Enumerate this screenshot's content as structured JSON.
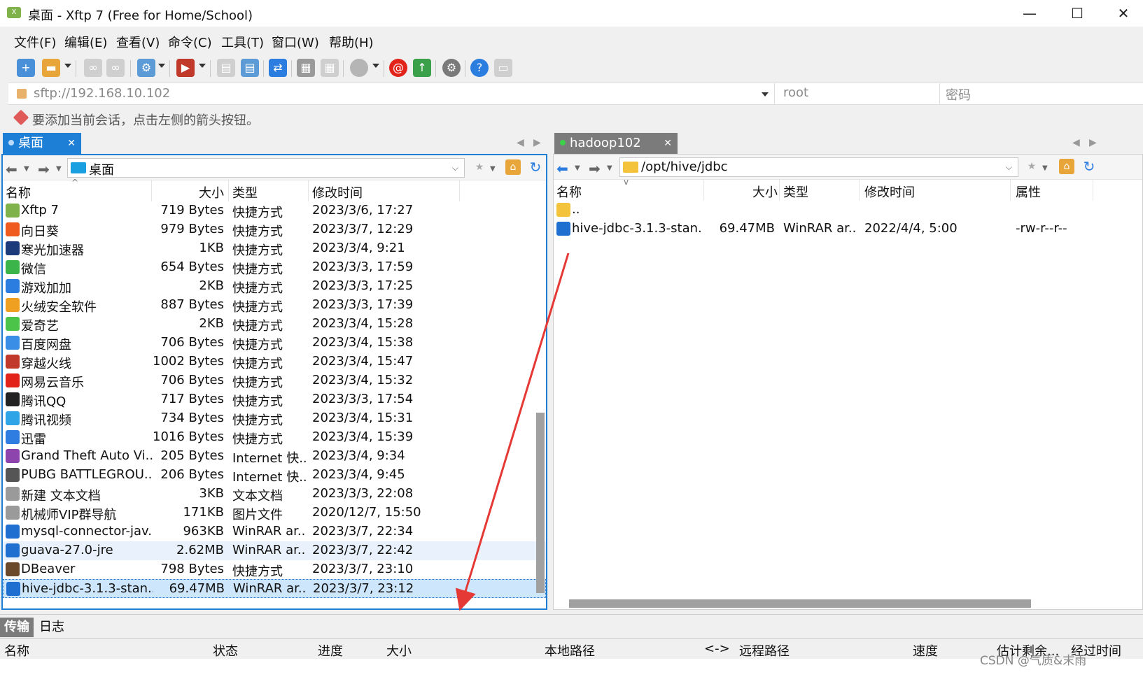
{
  "window": {
    "title": "桌面 - Xftp 7 (Free for Home/School)"
  },
  "menu": [
    "文件(F)",
    "编辑(E)",
    "查看(V)",
    "命令(C)",
    "工具(T)",
    "窗口(W)",
    "帮助(H)"
  ],
  "address": {
    "url": "sftp://192.168.10.102",
    "user": "root",
    "password": "密码"
  },
  "hint": "要添加当前会话，点击左侧的箭头按钮。",
  "local": {
    "tab": "桌面",
    "path": "桌面",
    "columns": [
      "名称",
      "大小",
      "类型",
      "修改时间"
    ],
    "files": [
      {
        "name": "Xftp 7",
        "size": "719 Bytes",
        "type": "快捷方式",
        "modified": "2023/3/6, 17:27",
        "icon": "xftp-icon",
        "color": "#7fb24a"
      },
      {
        "name": "向日葵",
        "size": "979 Bytes",
        "type": "快捷方式",
        "modified": "2023/3/7, 12:29",
        "icon": "sunflower-icon",
        "color": "#ef5a1f"
      },
      {
        "name": "寒光加速器",
        "size": "1KB",
        "type": "快捷方式",
        "modified": "2023/3/4, 9:21",
        "icon": "accelerator-icon",
        "color": "#1d3b7a"
      },
      {
        "name": "微信",
        "size": "654 Bytes",
        "type": "快捷方式",
        "modified": "2023/3/3, 17:59",
        "icon": "wechat-icon",
        "color": "#3bb54a"
      },
      {
        "name": "游戏加加",
        "size": "2KB",
        "type": "快捷方式",
        "modified": "2023/3/3, 17:25",
        "icon": "game-icon",
        "color": "#2b7de0"
      },
      {
        "name": "火绒安全软件",
        "size": "887 Bytes",
        "type": "快捷方式",
        "modified": "2023/3/3, 17:39",
        "icon": "huorong-icon",
        "color": "#f0a020"
      },
      {
        "name": "爱奇艺",
        "size": "2KB",
        "type": "快捷方式",
        "modified": "2023/3/4, 15:28",
        "icon": "iqiyi-icon",
        "color": "#4cc44a"
      },
      {
        "name": "百度网盘",
        "size": "706 Bytes",
        "type": "快捷方式",
        "modified": "2023/3/4, 15:38",
        "icon": "baidu-pan-icon",
        "color": "#3a8ee6"
      },
      {
        "name": "穿越火线",
        "size": "1002 Bytes",
        "type": "快捷方式",
        "modified": "2023/3/4, 15:47",
        "icon": "crossfire-icon",
        "color": "#c0392b"
      },
      {
        "name": "网易云音乐",
        "size": "706 Bytes",
        "type": "快捷方式",
        "modified": "2023/3/4, 15:32",
        "icon": "netease-music-icon",
        "color": "#e2231a"
      },
      {
        "name": "腾讯QQ",
        "size": "717 Bytes",
        "type": "快捷方式",
        "modified": "2023/3/3, 17:54",
        "icon": "qq-icon",
        "color": "#222222"
      },
      {
        "name": "腾讯视频",
        "size": "734 Bytes",
        "type": "快捷方式",
        "modified": "2023/3/4, 15:31",
        "icon": "tencent-video-icon",
        "color": "#2fa4e7"
      },
      {
        "name": "迅雷",
        "size": "1016 Bytes",
        "type": "快捷方式",
        "modified": "2023/3/4, 15:39",
        "icon": "thunder-icon",
        "color": "#2f7de1"
      },
      {
        "name": "Grand Theft Auto Vi...",
        "size": "205 Bytes",
        "type": "Internet 快...",
        "modified": "2023/3/4, 9:34",
        "icon": "gta-icon",
        "color": "#8e44ad"
      },
      {
        "name": "PUBG BATTLEGROU...",
        "size": "206 Bytes",
        "type": "Internet 快...",
        "modified": "2023/3/4, 9:45",
        "icon": "pubg-icon",
        "color": "#555555"
      },
      {
        "name": "新建 文本文档",
        "size": "3KB",
        "type": "文本文档",
        "modified": "2023/3/3, 22:08",
        "icon": "text-file-icon",
        "color": "#9a9a9a"
      },
      {
        "name": "机械师VIP群导航",
        "size": "171KB",
        "type": "图片文件",
        "modified": "2020/12/7, 15:50",
        "icon": "image-file-icon",
        "color": "#9a9a9a"
      },
      {
        "name": "mysql-connector-jav...",
        "size": "963KB",
        "type": "WinRAR ar...",
        "modified": "2023/3/7, 22:34",
        "icon": "archive-icon",
        "color": "#1f6fd1"
      },
      {
        "name": "guava-27.0-jre",
        "size": "2.62MB",
        "type": "WinRAR ar...",
        "modified": "2023/3/7, 22:42",
        "icon": "archive-icon",
        "color": "#1f6fd1"
      },
      {
        "name": "DBeaver",
        "size": "798 Bytes",
        "type": "快捷方式",
        "modified": "2023/3/7, 23:10",
        "icon": "dbeaver-icon",
        "color": "#6b4a2b"
      },
      {
        "name": "hive-jdbc-3.1.3-stan...",
        "size": "69.47MB",
        "type": "WinRAR ar...",
        "modified": "2023/3/7, 23:12",
        "icon": "archive-icon",
        "color": "#1f6fd1"
      }
    ]
  },
  "remote": {
    "tab": "hadoop102",
    "path": "/opt/hive/jdbc",
    "columns": [
      "名称",
      "大小",
      "类型",
      "修改时间",
      "属性"
    ],
    "files": [
      {
        "name": "..",
        "size": "",
        "type": "",
        "modified": "",
        "attr": "",
        "icon": "folder-icon",
        "color": "#f3c33c"
      },
      {
        "name": "hive-jdbc-3.1.3-stan...",
        "size": "69.47MB",
        "type": "WinRAR ar...",
        "modified": "2022/4/4, 5:00",
        "attr": "-rw-r--r--",
        "icon": "archive-icon",
        "color": "#1f6fd1"
      }
    ]
  },
  "bottom": {
    "tabs": [
      "传输",
      "日志"
    ],
    "columns": [
      "名称",
      "状态",
      "进度",
      "大小",
      "本地路径",
      "<->",
      "远程路径",
      "速度",
      "估计剩余...",
      "经过时间"
    ]
  },
  "watermark": "CSDN @气质&末雨"
}
